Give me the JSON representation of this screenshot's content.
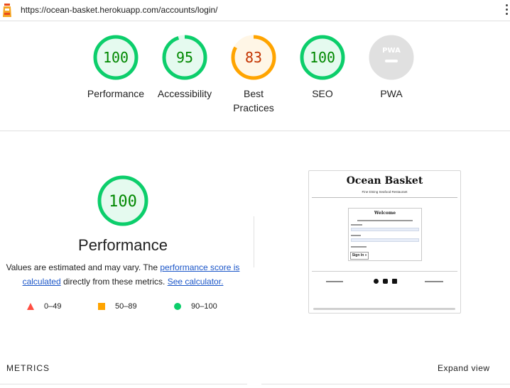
{
  "browser": {
    "url": "https://ocean-basket.herokuapp.com/accounts/login/"
  },
  "scores": [
    {
      "label": "Performance",
      "value": "100",
      "score": 100,
      "status": "pass"
    },
    {
      "label": "Accessibility",
      "value": "95",
      "score": 95,
      "status": "pass"
    },
    {
      "label": "Best Practices",
      "value": "83",
      "score": 83,
      "status": "average"
    },
    {
      "label": "SEO",
      "value": "100",
      "score": 100,
      "status": "pass"
    },
    {
      "label": "PWA",
      "value": "PWA",
      "score": 0,
      "status": "na"
    }
  ],
  "colors": {
    "pass": "#0cce6b",
    "pass_fill": "#e5faef",
    "pass_text": "#008800",
    "average": "#ffa400",
    "average_fill": "#fff6e6",
    "average_text": "#c33300",
    "fail": "#ff4e42",
    "na": "#e0e0e0",
    "link": "#1a55c8"
  },
  "performance": {
    "score": "100",
    "title": "Performance",
    "desc_part1": "Values are estimated and may vary. The ",
    "link1": "performance score is calculated",
    "desc_part2": " directly from these metrics. ",
    "link2": "See calculator."
  },
  "legend": [
    {
      "icon": "triangle-icon",
      "range": "0–49"
    },
    {
      "icon": "square-icon",
      "range": "50–89"
    },
    {
      "icon": "circle-icon",
      "range": "90–100"
    }
  ],
  "screenshot": {
    "brand": "Ocean Basket",
    "tagline": "Fine Dining Seafood Restaurant",
    "card_title": "Welcome",
    "button": "Sign In »"
  },
  "metrics": {
    "title": "METRICS",
    "expand": "Expand view"
  }
}
